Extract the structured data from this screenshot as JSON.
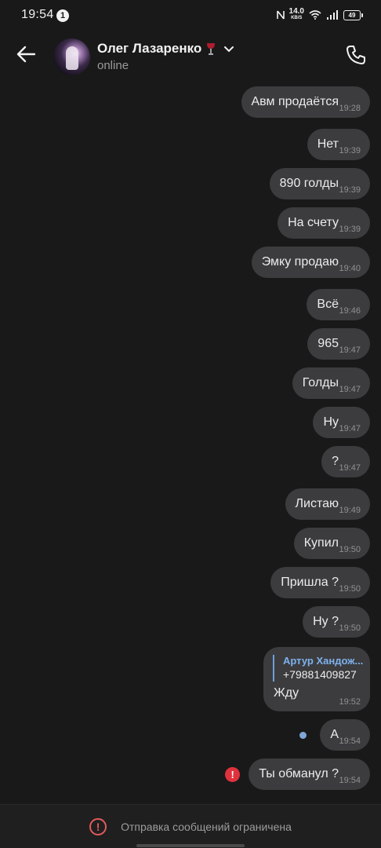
{
  "status_bar": {
    "time": "19:54",
    "notification_count": "1",
    "net_speed_value": "14.0",
    "net_speed_unit": "KB/S",
    "battery": "49"
  },
  "header": {
    "contact_name": "Олег Лазаренко",
    "contact_emoji": "wine-glass-icon",
    "status": "online"
  },
  "messages": [
    {
      "text": "Авм продаётся",
      "time": "19:28"
    },
    {
      "text": "Нет",
      "time": "19:39"
    },
    {
      "text": "890 голды",
      "time": "19:39"
    },
    {
      "text": "На счету",
      "time": "19:39"
    },
    {
      "text": "Эмку продаю",
      "time": "19:40"
    },
    {
      "text": "Всё",
      "time": "19:46"
    },
    {
      "text": "965",
      "time": "19:47"
    },
    {
      "text": "Голды",
      "time": "19:47"
    },
    {
      "text": "Ну",
      "time": "19:47"
    },
    {
      "text": "?",
      "time": "19:47"
    },
    {
      "text": "Листаю",
      "time": "19:49"
    },
    {
      "text": "Купил",
      "time": "19:50"
    },
    {
      "text": "Пришла ?",
      "time": "19:50"
    },
    {
      "text": "Ну ?",
      "time": "19:50"
    }
  ],
  "reply_message": {
    "quote_author": "Артур Хандож...",
    "quote_text": "+79881409827",
    "text": "Жду",
    "time": "19:52"
  },
  "unread_message": {
    "text": "А",
    "time": "19:54"
  },
  "failed_message": {
    "text": "Ты обманул ?",
    "time": "19:54"
  },
  "bottom_bar": {
    "restriction_text": "Отправка сообщений ограничена"
  },
  "colors": {
    "background": "#19191a",
    "bubble": "#3c3c3e",
    "accent_blue": "#7eb2ee",
    "error_red": "#e0323d"
  }
}
